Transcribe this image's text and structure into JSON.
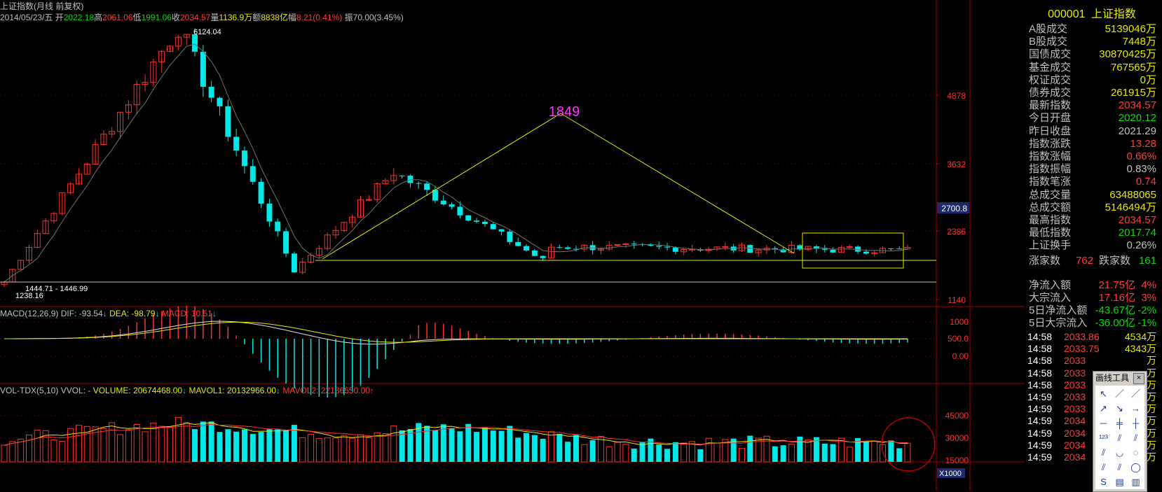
{
  "title": "上证指数(月线 前复权)",
  "ohlc_line": {
    "date": "2014/05/23/五",
    "open_label": "开",
    "open": "2022.18",
    "high_label": "高",
    "high": "2061.06",
    "low_label": "低",
    "low": "1991.06",
    "close_label": "收",
    "close": "2034.57",
    "vol_label": "量",
    "vol": "1136.9万",
    "amt_label": "额",
    "amt": "8838亿",
    "chg_label": "幅",
    "chg": "8.21(0.41%)",
    "amp_label": "振",
    "amp": "70.00(3.45%)"
  },
  "price_panel": {
    "ticks": [
      "4878",
      "3632",
      "2386",
      "1140"
    ],
    "current_label": "2700.8",
    "annotations": {
      "peak": "6124.04",
      "low1": "1444.71 - 1446.99",
      "low0": "1238.16",
      "mid_peak": "1849"
    }
  },
  "macd_panel": {
    "name": "MACD(12,26,9)",
    "dif_label": "DIF: -93.54",
    "dif_arrow": "↓",
    "dea_label": "DEA: -98.79",
    "dea_arrow": "↓",
    "macd_label": "MACD: 10.51",
    "macd_arrow": "↓",
    "ticks": [
      "1000",
      "500.0",
      "0.00"
    ]
  },
  "vol_panel": {
    "name": "VOL-TDX(5,10)",
    "vvol_label": "VVOL: -",
    "volume_label": "VOLUME: 20674468.00",
    "volume_arrow": "↓",
    "mavol1_label": "MAVOL1: 20132966.00",
    "mavol1_arrow": "↓",
    "mavol2_label": "MAVOL2: 22136550.00",
    "mavol2_arrow": "↑",
    "ticks": [
      "45000",
      "30000",
      "15000"
    ],
    "unit": "X1000"
  },
  "chart_data": {
    "type": "candlestick",
    "instrument": "上证指数",
    "period": "月线",
    "adjust": "前复权",
    "y_ticks": [
      4878,
      3632,
      2386,
      1140
    ],
    "series_pattern": [
      {
        "phase": "rise",
        "from": 1238.16,
        "to": 6124.04
      },
      {
        "phase": "fall",
        "from": 6124.04,
        "to": 1664.93
      },
      {
        "phase": "rebound",
        "from": 1664.93,
        "to": 3478.01
      },
      {
        "phase": "decline",
        "from": 3478.01,
        "to": 1849.65
      },
      {
        "phase": "range",
        "from": 2100,
        "to": 2034.57
      }
    ],
    "last_close": 2034.57,
    "current_price_marker": 2700.8
  },
  "side": {
    "code": "000001",
    "name": "上证指数",
    "rows": [
      {
        "label": "A股成交",
        "value": "5139046万",
        "color": "#e8e800"
      },
      {
        "label": "B股成交",
        "value": "7448万",
        "color": "#e8e800"
      },
      {
        "label": "国债成交",
        "value": "30870425万",
        "color": "#e8e800"
      },
      {
        "label": "基金成交",
        "value": "767565万",
        "color": "#e8e800"
      },
      {
        "label": "权证成交",
        "value": "0万",
        "color": "#e8e800"
      },
      {
        "label": "债券成交",
        "value": "261915万",
        "color": "#e8e800"
      },
      {
        "label": "最新指数",
        "value": "2034.57",
        "color": "#ff3b3b"
      },
      {
        "label": "今日开盘",
        "value": "2020.12",
        "color": "#00e000"
      },
      {
        "label": "昨日收盘",
        "value": "2021.29",
        "color": "#c0c0c0"
      },
      {
        "label": "指数涨跌",
        "value": "13.28",
        "color": "#ff3b3b"
      },
      {
        "label": "指数涨幅",
        "value": "0.66%",
        "color": "#ff3b3b"
      },
      {
        "label": "指数振幅",
        "value": "0.83%",
        "color": "#c0c0c0"
      },
      {
        "label": "指数笔涨",
        "value": "0.74",
        "color": "#ff3b3b"
      },
      {
        "label": "总成交量",
        "value": "63488065",
        "color": "#e8e800"
      },
      {
        "label": "总成交额",
        "value": "5146494万",
        "color": "#e8e800"
      },
      {
        "label": "最高指数",
        "value": "2034.57",
        "color": "#ff3b3b"
      },
      {
        "label": "最低指数",
        "value": "2017.74",
        "color": "#00e000"
      },
      {
        "label": "上证换手",
        "value": "0.26%",
        "color": "#c0c0c0"
      }
    ],
    "breadth": {
      "up_label": "涨家数",
      "up": "762",
      "down_label": "跌家数",
      "down": "161"
    },
    "flows": [
      {
        "label": "净流入额",
        "value": "21.75亿",
        "pct": "4%",
        "color": "#ff3b3b"
      },
      {
        "label": "大宗流入",
        "value": "17.16亿",
        "pct": "3%",
        "color": "#ff3b3b"
      },
      {
        "label": "5日净流入额",
        "value": "-43.67亿",
        "pct": "-2%",
        "color": "#00e000"
      },
      {
        "label": "5日大宗流入",
        "value": "-36.00亿",
        "pct": "-1%",
        "color": "#00e000"
      }
    ],
    "ticks": [
      {
        "time": "14:58",
        "price": "2033.86",
        "vol": "4534万"
      },
      {
        "time": "14:58",
        "price": "2033.75",
        "vol": "4343万"
      },
      {
        "time": "14:58",
        "price": "2033",
        "vol": "万"
      },
      {
        "time": "14:58",
        "price": "2033",
        "vol": "万"
      },
      {
        "time": "14:58",
        "price": "2033",
        "vol": "万"
      },
      {
        "time": "14:59",
        "price": "2033",
        "vol": "万"
      },
      {
        "time": "14:59",
        "price": "2033",
        "vol": "万"
      },
      {
        "time": "14:59",
        "price": "2034",
        "vol": "万"
      },
      {
        "time": "14:59",
        "price": "2034",
        "vol": "万"
      },
      {
        "time": "14:59",
        "price": "2034",
        "vol": "万"
      },
      {
        "time": "14:59",
        "price": "2034",
        "vol": "万"
      }
    ]
  },
  "palette": {
    "title": "画线工具",
    "close": "×"
  },
  "colors": {
    "up": "#ff3030",
    "down": "#00e8e8",
    "ma": "#e8e800",
    "grid": "#8b0000"
  }
}
